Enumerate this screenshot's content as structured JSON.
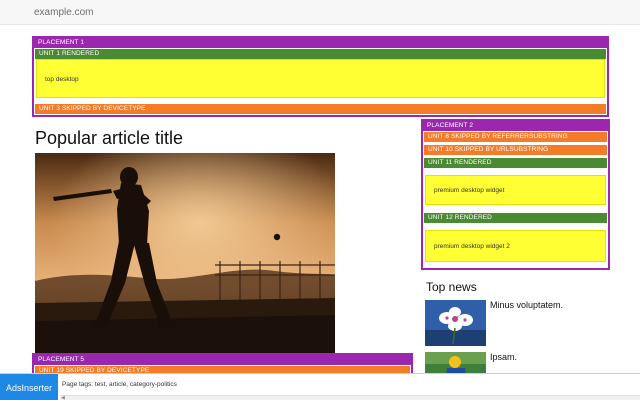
{
  "browser": {
    "url": "example.com"
  },
  "placement1": {
    "label": "PLACEMENT 1",
    "units": [
      {
        "label": "UNIT 1 RENDERED",
        "status": "rendered",
        "content": "top desktop"
      },
      {
        "label": "UNIT 3 SKIPPED BY DEVICETYPE",
        "status": "skipped"
      }
    ]
  },
  "placement2": {
    "label": "PLACEMENT 2",
    "units": [
      {
        "label": "UNIT 8 SKIPPED BY REFERRERSUBSTRING",
        "status": "skipped"
      },
      {
        "label": "UNIT 10 SKIPPED BY URLSUBSTRING",
        "status": "skipped"
      },
      {
        "label": "UNIT 11 RENDERED",
        "status": "rendered",
        "content": "premium desktop widget"
      },
      {
        "label": "UNIT 12 RENDERED",
        "status": "rendered",
        "content": "premium desktop widget 2"
      }
    ]
  },
  "placement5": {
    "label": "PLACEMENT 5",
    "units": [
      {
        "label": "UNIT 19 SKIPPED BY DEVICETYPE",
        "status": "skipped"
      }
    ]
  },
  "article": {
    "title": "Popular article title",
    "image": "cricket-batsman-silhouette"
  },
  "top_news": {
    "title": "Top news",
    "items": [
      {
        "text": "Minus voluptatem.",
        "image": "orchid-flowers"
      },
      {
        "text": "Ipsam.",
        "image": "cyclist"
      }
    ]
  },
  "toolbar": {
    "brand_label": "AdsInserter",
    "page_tags": "Page tags: test, article, category-politics"
  },
  "colors": {
    "placement": "#9b27af",
    "rendered": "#4a8a33",
    "skipped": "#f47b28",
    "ad_body": "#ffff33",
    "brand": "#1e88e5"
  }
}
